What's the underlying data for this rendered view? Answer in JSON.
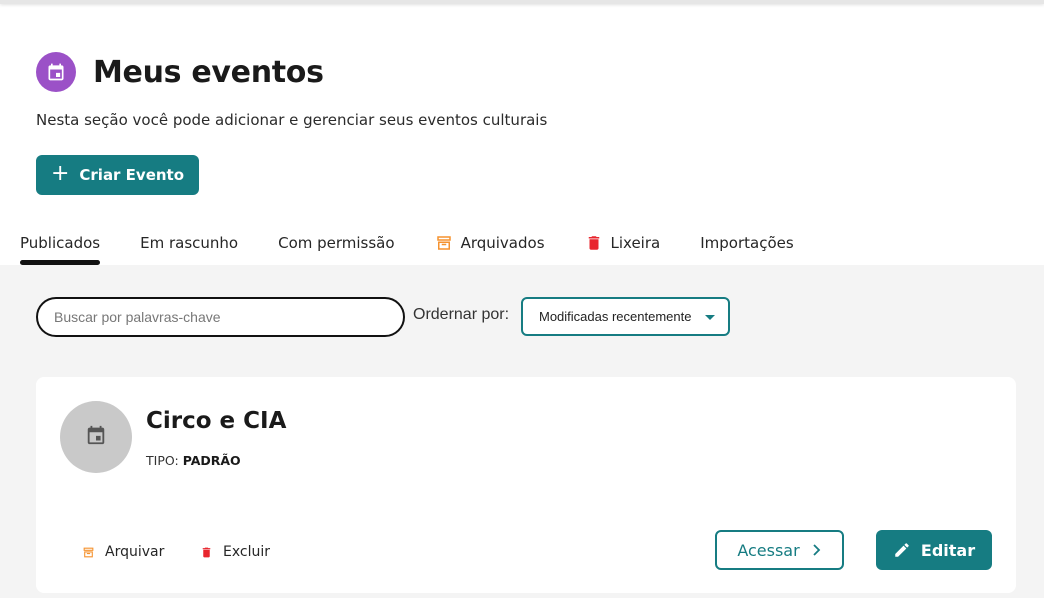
{
  "header": {
    "title": "Meus eventos",
    "subtitle": "Nesta seção você pode adicionar e gerenciar seus eventos culturais",
    "icon": "calendar-icon",
    "icon_color": "#9b51c7"
  },
  "create_button": {
    "label": "Criar Evento",
    "icon": "plus-icon"
  },
  "tabs": [
    {
      "label": "Publicados",
      "active": true
    },
    {
      "label": "Em rascunho"
    },
    {
      "label": "Com permissão"
    },
    {
      "label": "Arquivados",
      "icon": "archive-icon"
    },
    {
      "label": "Lixeira",
      "icon": "trash-icon"
    },
    {
      "label": "Importações"
    }
  ],
  "filters": {
    "search_placeholder": "Buscar por palavras-chave",
    "search_value": "",
    "order_label": "Ordernar por:",
    "order_selected": "Modificadas recentemente"
  },
  "event_card": {
    "title": "Circo e CIA",
    "type_label": "TIPO:",
    "type_value": "PADRÃO",
    "archive_label": "Arquivar",
    "delete_label": "Excluir",
    "access_label": "Acessar",
    "edit_label": "Editar"
  },
  "colors": {
    "primary": "#167c82",
    "archive_icon": "#f5922f",
    "trash_icon": "#e8262e",
    "content_bg": "#f4f4f4"
  }
}
